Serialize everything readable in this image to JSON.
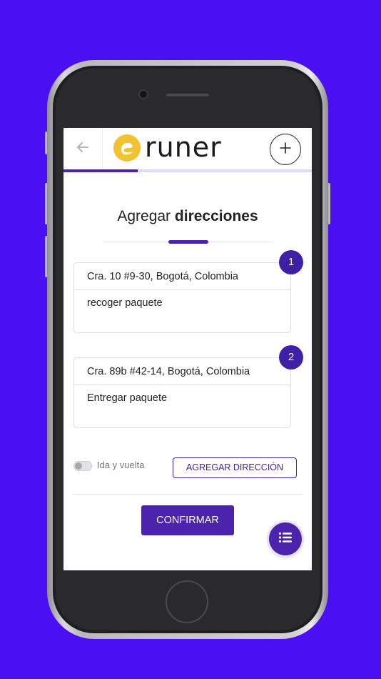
{
  "app": {
    "brand": "runer"
  },
  "header": {
    "title_regular": "Agregar",
    "title_bold": "direcciones"
  },
  "progress": {
    "value": 0.3
  },
  "stops": [
    {
      "number": "1",
      "address": "Cra. 10 #9-30, Bogotá, Colombia",
      "note": "recoger paquete"
    },
    {
      "number": "2",
      "address": "Cra. 89b #42-14, Bogotá, Colombia",
      "note": "Entregar paquete"
    }
  ],
  "round_trip": {
    "label": "Ida y vuelta",
    "enabled": false
  },
  "actions": {
    "add_address": "AGREGAR DIRECCIÓN",
    "confirm": "CONFIRMAR"
  },
  "colors": {
    "background": "#4a0ff2",
    "accent": "#4b23ad",
    "logo_mark": "#f2c230"
  },
  "icons": {
    "back": "arrow-left-icon",
    "add": "plus-icon",
    "menu": "list-icon",
    "logo": "runer-logo-mark"
  }
}
